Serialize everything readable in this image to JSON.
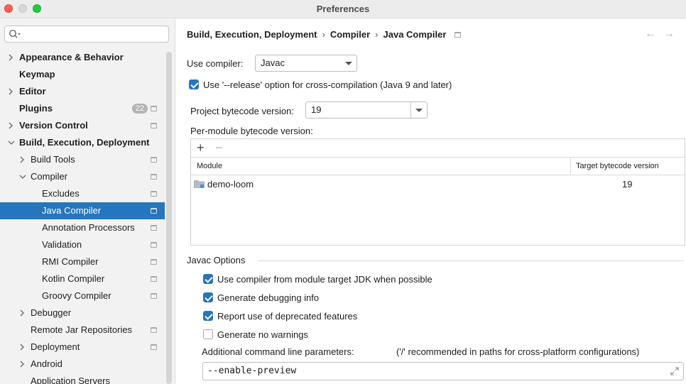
{
  "window": {
    "title": "Preferences"
  },
  "search": {
    "placeholder": ""
  },
  "sidebar": {
    "items": [
      {
        "label": "Appearance & Behavior"
      },
      {
        "label": "Keymap"
      },
      {
        "label": "Editor"
      },
      {
        "label": "Plugins",
        "badge": "22"
      },
      {
        "label": "Version Control"
      },
      {
        "label": "Build, Execution, Deployment"
      },
      {
        "label": "Build Tools"
      },
      {
        "label": "Compiler"
      },
      {
        "label": "Excludes"
      },
      {
        "label": "Java Compiler"
      },
      {
        "label": "Annotation Processors"
      },
      {
        "label": "Validation"
      },
      {
        "label": "RMI Compiler"
      },
      {
        "label": "Kotlin Compiler"
      },
      {
        "label": "Groovy Compiler"
      },
      {
        "label": "Debugger"
      },
      {
        "label": "Remote Jar Repositories"
      },
      {
        "label": "Deployment"
      },
      {
        "label": "Android"
      },
      {
        "label": "Application Servers"
      }
    ]
  },
  "breadcrumb": {
    "level1": "Build, Execution, Deployment",
    "level2": "Compiler",
    "level3": "Java Compiler",
    "separator": "›"
  },
  "nav": {
    "back": "←",
    "forward": "→"
  },
  "compiler": {
    "use_compiler_label": "Use compiler:",
    "use_compiler_value": "Javac",
    "release_option_label": "Use '--release' option for cross-compilation (Java 9 and later)",
    "release_option_checked": true,
    "bytecode_label": "Project bytecode version:",
    "bytecode_value": "19",
    "per_module_label": "Per-module bytecode version:"
  },
  "table": {
    "add": "+",
    "remove": "−",
    "col_module": "Module",
    "col_target": "Target bytecode version",
    "rows": [
      {
        "module": "demo-loom",
        "target": "19"
      }
    ]
  },
  "javac": {
    "section_title": "Javac Options",
    "options": [
      {
        "label": "Use compiler from module target JDK when possible",
        "checked": true
      },
      {
        "label": "Generate debugging info",
        "checked": true
      },
      {
        "label": "Report use of deprecated features",
        "checked": true
      },
      {
        "label": "Generate no warnings",
        "checked": false
      }
    ],
    "params_label": "Additional command line parameters:",
    "params_hint": "('/' recommended in paths for cross-platform configurations)",
    "params_value": "--enable-preview"
  },
  "colors": {
    "accent": "#2675bf",
    "sidebar_bg": "#f2f2f2"
  }
}
